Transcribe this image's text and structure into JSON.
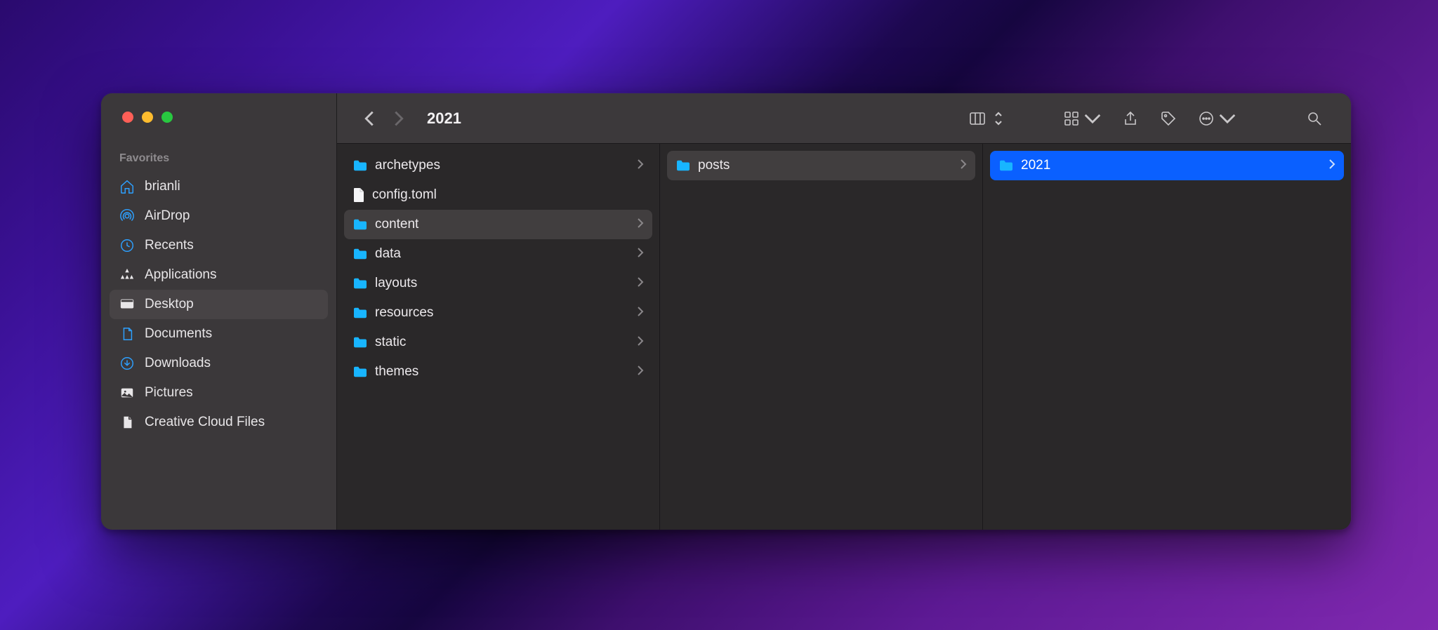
{
  "colors": {
    "folder": "#18b5ff",
    "sidebar_icon": "#2da0ff",
    "selection_blue": "#0a60ff"
  },
  "window": {
    "title": "2021"
  },
  "sidebar": {
    "section_label": "Favorites",
    "items": [
      {
        "icon": "home",
        "label": "brianli",
        "selected": false
      },
      {
        "icon": "airdrop",
        "label": "AirDrop",
        "selected": false
      },
      {
        "icon": "clock",
        "label": "Recents",
        "selected": false
      },
      {
        "icon": "apps",
        "label": "Applications",
        "selected": false
      },
      {
        "icon": "desktop",
        "label": "Desktop",
        "selected": true
      },
      {
        "icon": "document",
        "label": "Documents",
        "selected": false
      },
      {
        "icon": "download",
        "label": "Downloads",
        "selected": false
      },
      {
        "icon": "pictures",
        "label": "Pictures",
        "selected": false
      },
      {
        "icon": "ccfiles",
        "label": "Creative Cloud Files",
        "selected": false
      }
    ]
  },
  "toolbar": {
    "back_enabled": true,
    "forward_enabled": false,
    "view_mode": "column",
    "group_label": "grid",
    "actions": [
      "share",
      "tags",
      "more"
    ],
    "search_label": "search"
  },
  "columns": [
    {
      "items": [
        {
          "name": "archetypes",
          "type": "folder",
          "has_children": true,
          "state": "none"
        },
        {
          "name": "config.toml",
          "type": "file",
          "has_children": false,
          "state": "none"
        },
        {
          "name": "content",
          "type": "folder",
          "has_children": true,
          "state": "selected"
        },
        {
          "name": "data",
          "type": "folder",
          "has_children": true,
          "state": "none"
        },
        {
          "name": "layouts",
          "type": "folder",
          "has_children": true,
          "state": "none"
        },
        {
          "name": "resources",
          "type": "folder",
          "has_children": true,
          "state": "none"
        },
        {
          "name": "static",
          "type": "folder",
          "has_children": true,
          "state": "none"
        },
        {
          "name": "themes",
          "type": "folder",
          "has_children": true,
          "state": "none"
        }
      ]
    },
    {
      "items": [
        {
          "name": "posts",
          "type": "folder",
          "has_children": true,
          "state": "selected"
        }
      ]
    },
    {
      "items": [
        {
          "name": "2021",
          "type": "folder",
          "has_children": true,
          "state": "active"
        }
      ]
    }
  ]
}
